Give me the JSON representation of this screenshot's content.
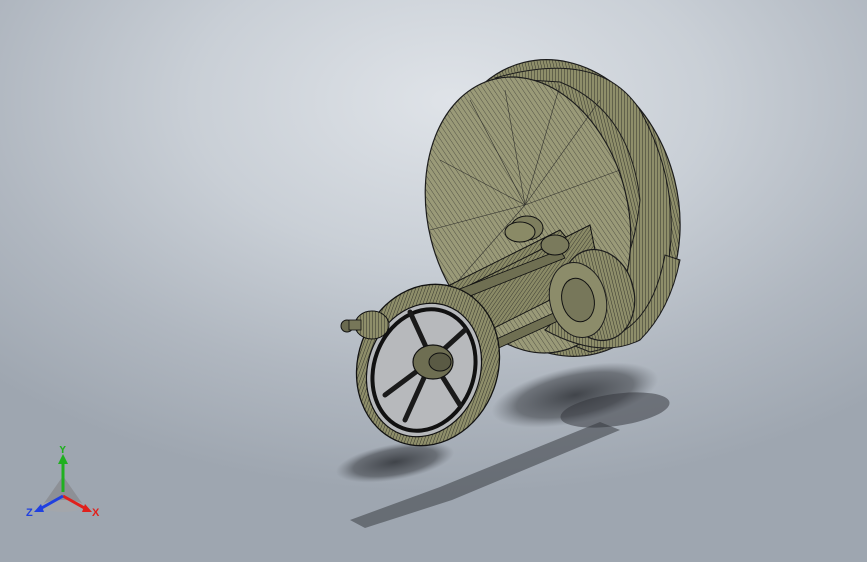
{
  "view": {
    "background_top": "#dfe3e8",
    "background_bottom": "#9ea6b0",
    "model_color": "#8f8f6c",
    "edge_color": "#1c1c1c",
    "shadow_color": "#3a3d42"
  },
  "triad": {
    "x_label": "X",
    "y_label": "Y",
    "z_label": "Z",
    "x_color": "#e0201c",
    "y_color": "#20b020",
    "z_color": "#2040e0"
  },
  "model": {
    "parts": [
      "large-flywheel",
      "gear-wheel",
      "pulley",
      "crankshaft-assembly",
      "motor-pinion"
    ]
  }
}
